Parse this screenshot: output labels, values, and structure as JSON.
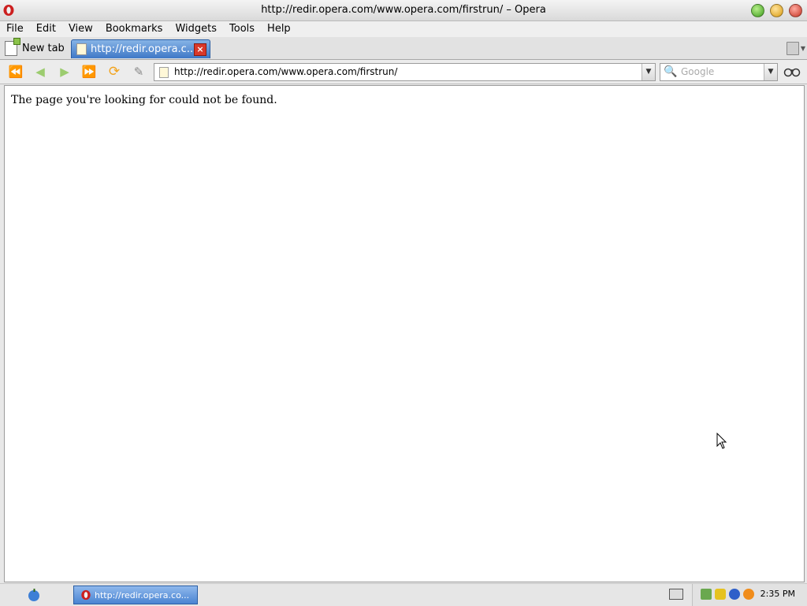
{
  "window": {
    "title": "http://redir.opera.com/www.opera.com/firstrun/ – Opera"
  },
  "menubar": {
    "items": [
      "File",
      "Edit",
      "View",
      "Bookmarks",
      "Widgets",
      "Tools",
      "Help"
    ]
  },
  "tabs": {
    "new_tab_label": "New tab",
    "active_label": "http://redir.opera.c..."
  },
  "address": {
    "url": "http://redir.opera.com/www.opera.com/firstrun/"
  },
  "search": {
    "placeholder": "Google"
  },
  "page": {
    "message": "The page you're looking for could not be found."
  },
  "taskbar": {
    "task_label": "http://redir.opera.co...",
    "clock": "2:35 PM"
  },
  "colors": {
    "accent": "#3f78c7",
    "opera_red": "#cc1f1f"
  },
  "icons": [
    "opera-icon",
    "rewind-icon",
    "back-icon",
    "forward-icon",
    "fast-forward-icon",
    "reload-icon",
    "edit-icon",
    "page-icon",
    "search-icon",
    "binoculars-icon",
    "trash-icon",
    "apple-icon",
    "keyboard-icon"
  ]
}
